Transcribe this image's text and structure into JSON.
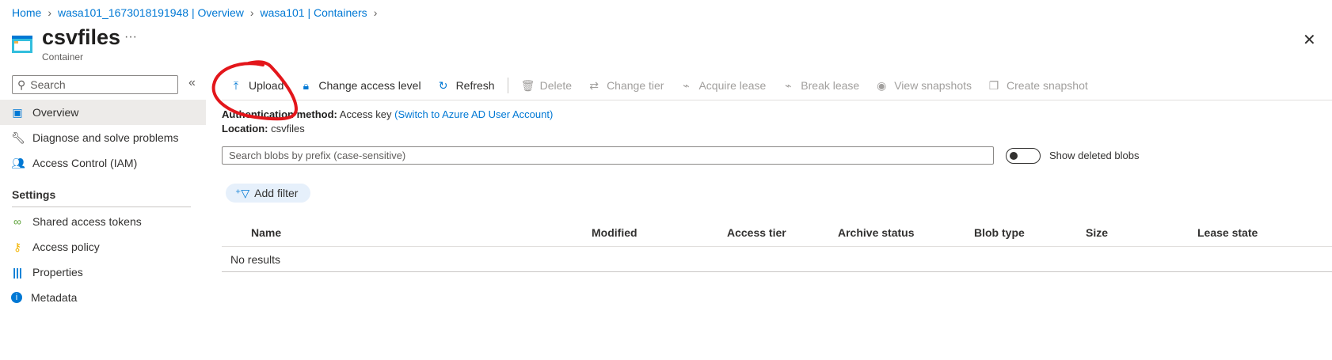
{
  "breadcrumb": [
    "Home",
    "wasa101_1673018191948 | Overview",
    "wasa101 | Containers"
  ],
  "header": {
    "title": "csvfiles",
    "subtitle": "Container",
    "more": "···",
    "close": "✕"
  },
  "sidebar": {
    "search_placeholder": "Search",
    "collapse": "«",
    "items": [
      {
        "label": "Overview"
      },
      {
        "label": "Diagnose and solve problems"
      },
      {
        "label": "Access Control (IAM)"
      }
    ],
    "section": "Settings",
    "settings_items": [
      {
        "label": "Shared access tokens"
      },
      {
        "label": "Access policy"
      },
      {
        "label": "Properties"
      },
      {
        "label": "Metadata"
      }
    ]
  },
  "toolbar": {
    "upload": "Upload",
    "change_access": "Change access level",
    "refresh": "Refresh",
    "delete": "Delete",
    "change_tier": "Change tier",
    "acquire_lease": "Acquire lease",
    "break_lease": "Break lease",
    "view_snapshots": "View snapshots",
    "create_snapshot": "Create snapshot"
  },
  "info": {
    "auth_label": "Authentication method:",
    "auth_value": "Access key",
    "auth_link": "(Switch to Azure AD User Account)",
    "location_label": "Location:",
    "location_value": "csvfiles"
  },
  "blob_search": {
    "placeholder": "Search blobs by prefix (case-sensitive)"
  },
  "show_deleted": {
    "label": "Show deleted blobs",
    "on": false
  },
  "add_filter": "Add filter",
  "table": {
    "columns": [
      "Name",
      "Modified",
      "Access tier",
      "Archive status",
      "Blob type",
      "Size",
      "Lease state"
    ],
    "empty": "No results"
  },
  "colors": {
    "accent": "#0078d4",
    "annotation": "#e3161b"
  }
}
